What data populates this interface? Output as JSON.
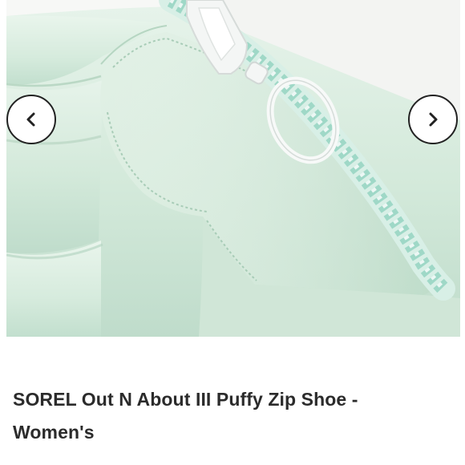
{
  "product": {
    "title": "SOREL Out N About III Puffy Zip Shoe - Women's"
  },
  "gallery": {
    "prev_icon": "chevron-left-icon",
    "next_icon": "chevron-right-icon"
  },
  "colors": {
    "shoe_mint": "#d7ecdf",
    "zipper_teal": "#9fd8c7",
    "button_border": "#222222"
  }
}
